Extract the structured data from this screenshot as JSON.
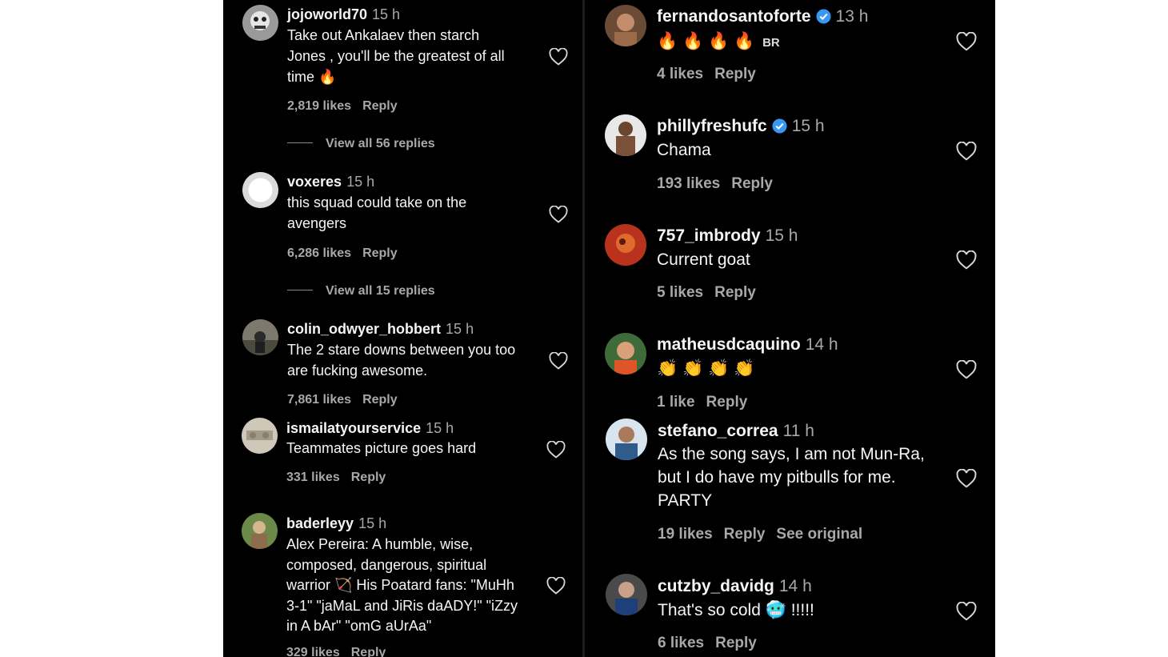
{
  "left_comments": [
    {
      "username": "jojoworld70",
      "time": "15 h",
      "lines": [
        "Take out Ankalaev then starch",
        "Jones , you'll be the greatest of all",
        "time 🔥"
      ],
      "likes": "2,819 likes",
      "reply": "Reply",
      "view_replies": "View all 56 replies"
    },
    {
      "username": "voxeres",
      "time": "15 h",
      "lines": [
        "this squad could take on the",
        "avengers"
      ],
      "likes": "6,286 likes",
      "reply": "Reply",
      "view_replies": "View all 15 replies"
    },
    {
      "username": "colin_odwyer_hobbert",
      "time": "15 h",
      "lines": [
        "The 2 stare downs between you too",
        "are fucking awesome."
      ],
      "likes": "7,861 likes",
      "reply": "Reply"
    },
    {
      "username": "ismailatyourservice",
      "time": "15 h",
      "lines": [
        "Teammates picture goes hard"
      ],
      "likes": "331 likes",
      "reply": "Reply"
    },
    {
      "username": "baderleyy",
      "time": "15 h",
      "lines": [
        "Alex Pereira: A humble, wise,",
        "composed, dangerous, spiritual",
        "warrior 🏹 His Poatard fans: \"MuHh",
        "3-1\" \"jaMaL and JiRis daADY!\" \"iZzy",
        "in A bAr\" \"omG aUrAa\""
      ],
      "likes": "329 likes",
      "reply": "Reply"
    }
  ],
  "right_comments": [
    {
      "username": "fernandosantoforte",
      "time": "13 h",
      "text": "🔥 🔥 🔥 🔥",
      "tag": "BR",
      "likes": "4 likes",
      "reply": "Reply"
    },
    {
      "username": "phillyfreshufc",
      "time": "15 h",
      "text": "Chama",
      "likes": "193 likes",
      "reply": "Reply"
    },
    {
      "username": "757_imbrody",
      "time": "15 h",
      "text": "Current goat",
      "likes": "5 likes",
      "reply": "Reply"
    },
    {
      "username": "matheusdcaquino",
      "time": "14 h",
      "text": "👏 👏 👏 👏",
      "likes": "1 like",
      "reply": "Reply"
    },
    {
      "username": "stefano_correa",
      "time": "11 h",
      "lines": [
        "As the song says, I am not Mun-Ra,",
        "but I do have my pitbulls for me.",
        "PARTY"
      ],
      "likes": "19 likes",
      "reply": "Reply",
      "see_original": "See original"
    },
    {
      "username": "cutzby_davidg",
      "time": "14 h",
      "text": "That's so cold 🥶 !!!!!",
      "likes": "6 likes",
      "reply": "Reply"
    }
  ],
  "icons": {
    "heart": "heart-outline-icon",
    "verified": "verified-badge-icon"
  },
  "colors": {
    "background": "#000000",
    "text": "#f5f5f5",
    "muted": "#a8a8a8",
    "verified": "#3897f0"
  }
}
